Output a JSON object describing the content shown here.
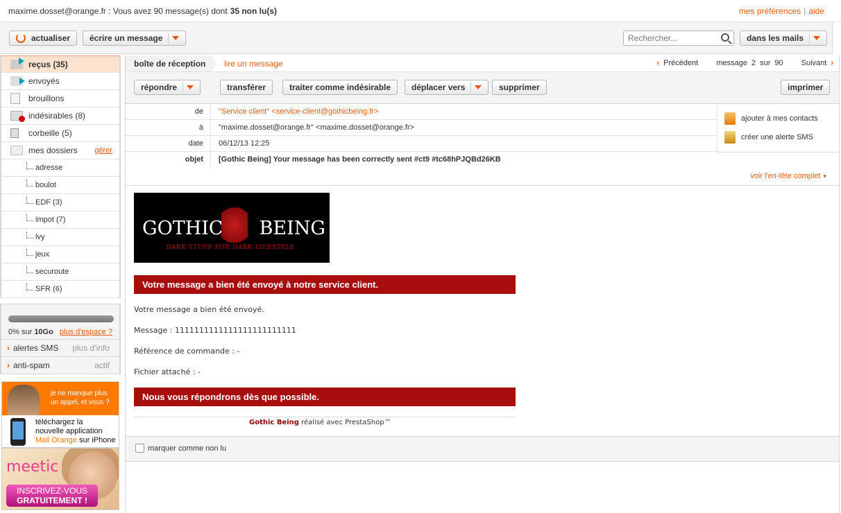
{
  "topbar": {
    "email": "maxime.dosset@orange.fr",
    "status_text": " : Vous avez 90 message(s) dont",
    "unread": "35 non lu(s)",
    "prefs": "mes préférences",
    "sep": "|",
    "help": "aide"
  },
  "toolbar": {
    "refresh": "actualiser",
    "compose": "écrire un message",
    "search_placeholder": "Rechercher...",
    "search_scope": "dans les mails"
  },
  "sidebar": {
    "folders": [
      {
        "label": "reçus (35)"
      },
      {
        "label": "envoyés"
      },
      {
        "label": "brouillons"
      },
      {
        "label": "indésirables (8)"
      },
      {
        "label": "corbeille (5)"
      },
      {
        "label": "mes dossiers",
        "action": "gérer"
      }
    ],
    "subfolders": [
      {
        "label": "adresse"
      },
      {
        "label": "boulot"
      },
      {
        "label": "EDF (3)"
      },
      {
        "label": "impot (7)"
      },
      {
        "label": "lvy"
      },
      {
        "label": "jeux"
      },
      {
        "label": "securoute"
      },
      {
        "label": "SFR (6)"
      }
    ],
    "quota": {
      "used_fraction": 0.0,
      "text_prefix": "0% sur",
      "total": "10Go",
      "more": "plus d'espace ?"
    },
    "extras": [
      {
        "label": "alertes SMS",
        "right": "plus d'info"
      },
      {
        "label": "anti-spam",
        "right": "actif"
      }
    ],
    "ad_orange": {
      "line1": "je ne manque plus",
      "line2": "un appel, et vous ?",
      "line3": "téléchargez la",
      "line4": "nouvelle application",
      "line5_brand": "Mail Orange",
      "line5_rest": " sur iPhone"
    },
    "ad_meetic": {
      "logo": "meetic",
      "cta1": "INSCRIVEZ-VOUS",
      "cta2": "GRATUITEMENT !"
    }
  },
  "main": {
    "breadcrumb": {
      "inbox": "boîte de réception",
      "current": "lire un message"
    },
    "nav": {
      "prev": "Précédent",
      "message_label": "message",
      "index": "2",
      "of": "sur",
      "total": "90",
      "next": "Suivant"
    },
    "actions": {
      "reply": "répondre",
      "forward": "transférer",
      "spam": "traiter comme indésirable",
      "move": "déplacer vers",
      "delete": "supprimer",
      "print": "imprimer"
    },
    "header": {
      "from_label": "de",
      "from": "\"Service client\" <service-client@gothicbeing.fr>",
      "to_label": "à",
      "to": "\"maxime.dosset@orange.fr\" <maxime.dosset@orange.fr>",
      "date_label": "date",
      "date": "06/12/13 12:25",
      "subject_label": "objet",
      "subject": "[Gothic Being] Your message has been correctly sent #ct9  #tc68hPJQBd26KB",
      "add_contact": "ajouter à mes contacts",
      "sms_alert": "créer une alerte SMS",
      "full_header": "voir l'en-tête complet"
    },
    "body": {
      "banner_title_left": "GOTHIC",
      "banner_title_right": "BEING",
      "banner_tagline": "DARK STUFF FOR DARK LIFESTYLE",
      "red1": "Votre message a bien été envoyé à notre service client.",
      "line1": "Votre message a bien été envoyé.",
      "line2": "Message : 1111111111111111111111111",
      "line3": "Référence de commande : -",
      "line4": "Fichier attaché : -",
      "red2": "Nous vous répondrons dès que possible.",
      "footer_brand": "Gothic Being",
      "footer_rest": " réalisé avec PrestaShop™"
    },
    "mark_unread": "marquer comme non lu"
  }
}
